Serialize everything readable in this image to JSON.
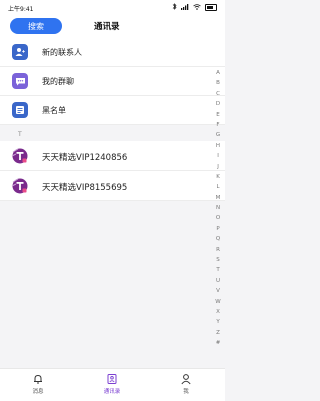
{
  "status_bar": {
    "time": "上午9:41",
    "icons": [
      "bluetooth-icon",
      "signal-icon",
      "wifi-icon",
      "battery-icon"
    ]
  },
  "header": {
    "search_label": "搜索",
    "title": "通讯录"
  },
  "entries": [
    {
      "label": "新的联系人",
      "icon": "add-contact-icon",
      "color": "#3a67c9"
    },
    {
      "label": "我的群聊",
      "icon": "group-chat-icon",
      "color": "#7b63d9"
    },
    {
      "label": "黑名单",
      "icon": "blacklist-icon",
      "color": "#3a67c9"
    }
  ],
  "section": {
    "letter": "T"
  },
  "contacts": [
    {
      "name": "天天精选VIP1240856",
      "avatar": "vip-logo-icon"
    },
    {
      "name": "天天精选VIP8155695",
      "avatar": "vip-logo-icon"
    }
  ],
  "alpha_index": [
    "A",
    "B",
    "C",
    "D",
    "E",
    "F",
    "G",
    "H",
    "I",
    "J",
    "K",
    "L",
    "M",
    "N",
    "O",
    "P",
    "Q",
    "R",
    "S",
    "T",
    "U",
    "V",
    "W",
    "X",
    "Y",
    "Z",
    "#"
  ],
  "bottom_nav": [
    {
      "label": "消息",
      "icon": "bell-icon",
      "active": false
    },
    {
      "label": "通讯录",
      "icon": "contacts-icon",
      "active": true
    },
    {
      "label": "我",
      "icon": "person-icon",
      "active": false
    }
  ],
  "colors": {
    "accent": "#2f73f0",
    "active_tab": "#7b3fd1",
    "avatar": "#7a2a8c"
  }
}
